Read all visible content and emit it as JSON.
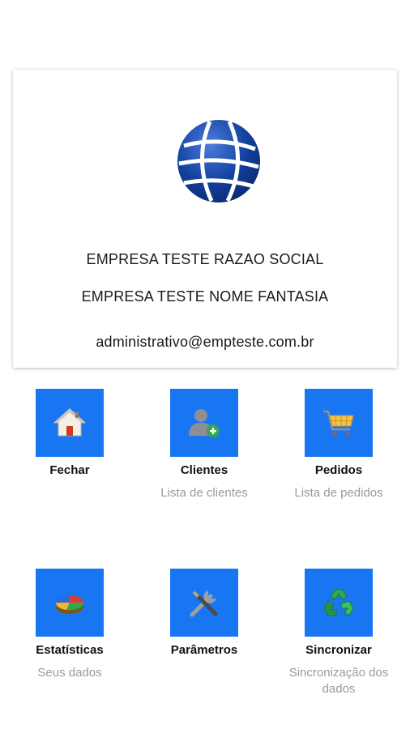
{
  "company": {
    "razao_social": "EMPRESA TESTE RAZAO SOCIAL",
    "nome_fantasia": "EMPRESA TESTE NOME FANTASIA",
    "email": "administrativo@empteste.com.br",
    "logo_icon": "globe-icon"
  },
  "menu": [
    {
      "title": "Fechar",
      "subtitle": "",
      "icon": "home-icon"
    },
    {
      "title": "Clientes",
      "subtitle": "Lista de clientes",
      "icon": "add-user-icon"
    },
    {
      "title": "Pedidos",
      "subtitle": "Lista de pedidos",
      "icon": "shopping-cart-icon"
    },
    {
      "title": "Estatísticas",
      "subtitle": "Seus dados",
      "icon": "pie-chart-icon"
    },
    {
      "title": "Parâmetros",
      "subtitle": "",
      "icon": "tools-icon"
    },
    {
      "title": "Sincronizar",
      "subtitle": "Sincronização dos dados",
      "icon": "recycle-icon"
    }
  ],
  "colors": {
    "tile": "#1976f2",
    "subtitle": "#9a9a9a",
    "globe": "#12409e"
  }
}
